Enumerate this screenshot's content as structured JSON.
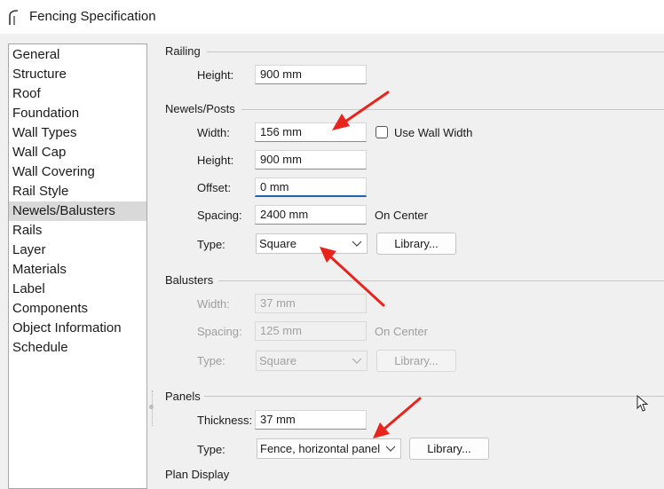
{
  "window": {
    "title": "Fencing Specification"
  },
  "nav": {
    "items": [
      "General",
      "Structure",
      "Roof",
      "Foundation",
      "Wall Types",
      "Wall Cap",
      "Wall Covering",
      "Rail Style",
      "Newels/Balusters",
      "Rails",
      "Layer",
      "Materials",
      "Label",
      "Components",
      "Object Information",
      "Schedule"
    ],
    "selected": "Newels/Balusters"
  },
  "railing": {
    "group_label": "Railing",
    "height_label": "Height:",
    "height_value": "900 mm"
  },
  "newels": {
    "group_label": "Newels/Posts",
    "width_label": "Width:",
    "width_value": "156 mm",
    "use_wall_width_label": "Use Wall Width",
    "use_wall_width_checked": false,
    "height_label": "Height:",
    "height_value": "900 mm",
    "offset_label": "Offset:",
    "offset_value": "0 mm",
    "spacing_label": "Spacing:",
    "spacing_value": "2400 mm",
    "spacing_suffix": "On Center",
    "type_label": "Type:",
    "type_value": "Square",
    "library_label": "Library..."
  },
  "balusters": {
    "group_label": "Balusters",
    "width_label": "Width:",
    "width_value": "37 mm",
    "spacing_label": "Spacing:",
    "spacing_value": "125 mm",
    "spacing_suffix": "On Center",
    "type_label": "Type:",
    "type_value": "Square",
    "library_label": "Library..."
  },
  "panels": {
    "group_label": "Panels",
    "thickness_label": "Thickness:",
    "thickness_value": "37 mm",
    "type_label": "Type:",
    "type_value": "Fence, horizontal panel",
    "library_label": "Library..."
  },
  "plan_display": {
    "group_label": "Plan Display"
  },
  "colors": {
    "arrow": "#e8241c",
    "focus": "#1e64b4"
  }
}
